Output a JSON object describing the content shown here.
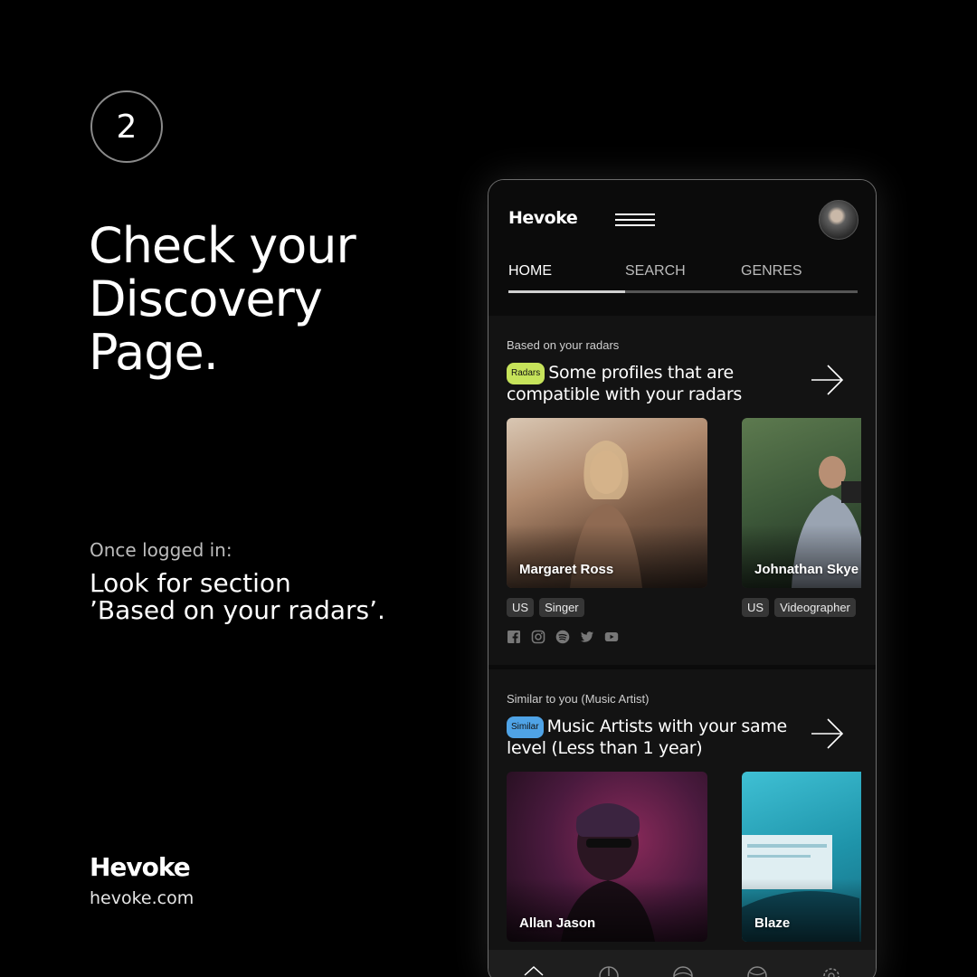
{
  "step_number": "2",
  "headline": [
    "Check your",
    "Discovery",
    "Page."
  ],
  "instruction": {
    "label": "Once logged in:",
    "lines": [
      "Look for section",
      "’Based on your radars’."
    ]
  },
  "brand": {
    "logo": "Hevoke",
    "url": "hevoke.com"
  },
  "app": {
    "logo": "Hevoke",
    "tabs": [
      {
        "label": "HOME",
        "active": true
      },
      {
        "label": "SEARCH",
        "active": false
      },
      {
        "label": "GENRES",
        "active": false
      }
    ],
    "sections": [
      {
        "label": "Based on your radars",
        "badge": "Radars",
        "badge_color": "#c6e35a",
        "title": "Some profiles that are compatible with your radars",
        "cards": [
          {
            "name": "Margaret Ross",
            "country": "US",
            "role": "Singer"
          },
          {
            "name": "Johnathan Skye",
            "country": "US",
            "role": "Videographer"
          }
        ],
        "social_icons": [
          "facebook-icon",
          "instagram-icon",
          "spotify-icon",
          "twitter-icon",
          "youtube-icon"
        ]
      },
      {
        "label": "Similar to you (Music Artist)",
        "badge": "Similar",
        "badge_color": "#4fa3e6",
        "title": "Music Artists with your same level (Less than 1 year)",
        "cards": [
          {
            "name": "Allan Jason"
          },
          {
            "name": "Blaze"
          }
        ]
      }
    ],
    "bottom_nav": [
      "home-icon",
      "radar-icon",
      "globe-icon",
      "discover-icon",
      "settings-icon"
    ]
  },
  "colors": {
    "background": "#000000",
    "panel": "#131313",
    "radars_badge": "#c6e35a",
    "similar_badge": "#4fa3e6"
  }
}
